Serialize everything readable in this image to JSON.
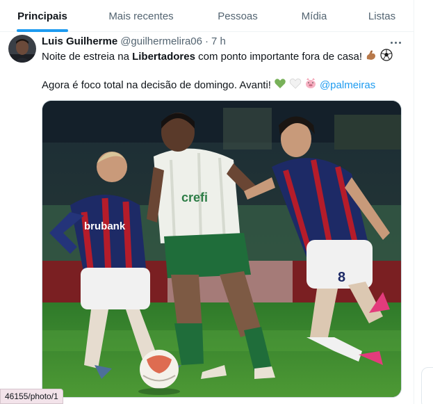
{
  "tabs": [
    {
      "label": "Principais",
      "active": true
    },
    {
      "label": "Mais recentes",
      "active": false
    },
    {
      "label": "Pessoas",
      "active": false
    },
    {
      "label": "Mídia",
      "active": false
    },
    {
      "label": "Listas",
      "active": false
    }
  ],
  "tweet": {
    "author_name": "Luis Guilherme",
    "handle": "@guilhermelira06",
    "separator": "·",
    "time": "7 h",
    "line1_pre": "Noite de estreia na ",
    "line1_bold": "Libertadores",
    "line1_post": " com ponto importante fora de casa!",
    "line2_text": "Agora é foco total na decisão de domingo. Avanti!",
    "mention": "@palmeiras",
    "icons": [
      "more-icon",
      "flexed-bicep-icon",
      "soccer-ball-icon",
      "green-heart-icon",
      "white-heart-icon",
      "pig-face-icon"
    ]
  },
  "photo": {
    "alt": "Football match photo",
    "sponsor_left": "brubank",
    "sponsor_center": "crefi",
    "player_number": "8"
  },
  "status_url": "46155/photo/1",
  "colors": {
    "accent": "#1d9bf0",
    "text": "#0f1419",
    "muted": "#536471",
    "border": "#eff3f4"
  }
}
